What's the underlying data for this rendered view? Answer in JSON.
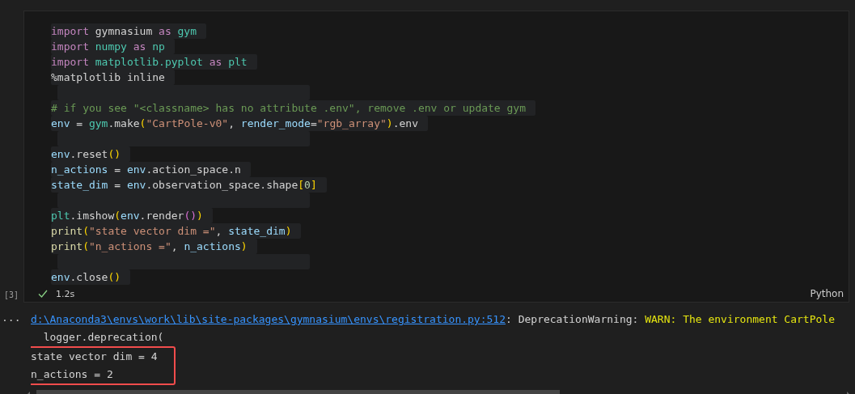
{
  "cell": {
    "execution_count": "[3]",
    "duration": "1.2s",
    "language": "Python",
    "lines": [
      {
        "tokens": [
          {
            "kind": "keyword",
            "text": "import"
          },
          {
            "kind": "plain",
            "text": " gymnasium "
          },
          {
            "kind": "keyword",
            "text": "as"
          },
          {
            "kind": "module",
            "text": " gym"
          }
        ]
      },
      {
        "tokens": [
          {
            "kind": "keyword",
            "text": "import"
          },
          {
            "kind": "module",
            "text": " numpy"
          },
          {
            "kind": "keyword",
            "text": " as"
          },
          {
            "kind": "module",
            "text": " np"
          }
        ]
      },
      {
        "tokens": [
          {
            "kind": "keyword",
            "text": "import"
          },
          {
            "kind": "module",
            "text": " matplotlib.pyplot"
          },
          {
            "kind": "keyword",
            "text": " as"
          },
          {
            "kind": "module",
            "text": " plt"
          }
        ]
      },
      {
        "tokens": [
          {
            "kind": "plain",
            "text": "%matplotlib inline"
          }
        ]
      },
      {
        "kind": "blank"
      },
      {
        "tokens": [
          {
            "kind": "comment",
            "text": "# if you see \"<classname> has no attribute .env\", remove .env or update gym"
          }
        ]
      },
      {
        "tokens": [
          {
            "kind": "var",
            "text": "env"
          },
          {
            "kind": "plain",
            "text": " = "
          },
          {
            "kind": "module",
            "text": "gym"
          },
          {
            "kind": "plain",
            "text": ".make"
          },
          {
            "kind": "paren",
            "text": "("
          },
          {
            "kind": "string",
            "text": "\"CartPole-v0\""
          },
          {
            "kind": "plain",
            "text": ", "
          },
          {
            "kind": "var",
            "text": "render_mode"
          },
          {
            "kind": "plain",
            "text": "="
          },
          {
            "kind": "string",
            "text": "\"rgb_array\""
          },
          {
            "kind": "paren",
            "text": ")"
          },
          {
            "kind": "plain",
            "text": ".env"
          }
        ]
      },
      {
        "kind": "blank"
      },
      {
        "tokens": [
          {
            "kind": "var",
            "text": "env"
          },
          {
            "kind": "plain",
            "text": ".reset"
          },
          {
            "kind": "paren",
            "text": "()"
          }
        ]
      },
      {
        "tokens": [
          {
            "kind": "var",
            "text": "n_actions"
          },
          {
            "kind": "plain",
            "text": " = "
          },
          {
            "kind": "var",
            "text": "env"
          },
          {
            "kind": "plain",
            "text": ".action_space.n"
          }
        ]
      },
      {
        "tokens": [
          {
            "kind": "var",
            "text": "state_dim"
          },
          {
            "kind": "plain",
            "text": " = "
          },
          {
            "kind": "var",
            "text": "env"
          },
          {
            "kind": "plain",
            "text": ".observation_space.shape"
          },
          {
            "kind": "paren",
            "text": "["
          },
          {
            "kind": "number",
            "text": "0"
          },
          {
            "kind": "paren",
            "text": "]"
          }
        ]
      },
      {
        "kind": "blank"
      },
      {
        "tokens": [
          {
            "kind": "module",
            "text": "plt"
          },
          {
            "kind": "plain",
            "text": ".imshow"
          },
          {
            "kind": "paren",
            "text": "("
          },
          {
            "kind": "var",
            "text": "env"
          },
          {
            "kind": "plain",
            "text": ".render"
          },
          {
            "kind": "paren2",
            "text": "()"
          },
          {
            "kind": "paren",
            "text": ")"
          }
        ]
      },
      {
        "tokens": [
          {
            "kind": "func",
            "text": "print"
          },
          {
            "kind": "paren",
            "text": "("
          },
          {
            "kind": "string",
            "text": "\"state vector dim =\""
          },
          {
            "kind": "plain",
            "text": ", "
          },
          {
            "kind": "var",
            "text": "state_dim"
          },
          {
            "kind": "paren",
            "text": ")"
          }
        ]
      },
      {
        "tokens": [
          {
            "kind": "func",
            "text": "print"
          },
          {
            "kind": "paren",
            "text": "("
          },
          {
            "kind": "string",
            "text": "\"n_actions =\""
          },
          {
            "kind": "plain",
            "text": ", "
          },
          {
            "kind": "var",
            "text": "n_actions"
          },
          {
            "kind": "paren",
            "text": ")"
          }
        ]
      },
      {
        "kind": "blank"
      },
      {
        "tokens": [
          {
            "kind": "var",
            "text": "env"
          },
          {
            "kind": "plain",
            "text": ".close"
          },
          {
            "kind": "paren",
            "text": "()"
          }
        ]
      }
    ]
  },
  "output": {
    "more": "...",
    "lines": [
      {
        "kind": "warning",
        "link": "d:\\Anaconda3\\envs\\work\\lib\\site-packages\\gymnasium\\envs\\registration.py:512",
        "label": ": DeprecationWarning: ",
        "message": "WARN: The environment CartPole"
      },
      {
        "kind": "plain",
        "text": "  logger.deprecation("
      },
      {
        "kind": "highlighted",
        "text": "state vector dim = 4"
      },
      {
        "kind": "highlighted",
        "text": "n_actions = 2"
      }
    ]
  }
}
